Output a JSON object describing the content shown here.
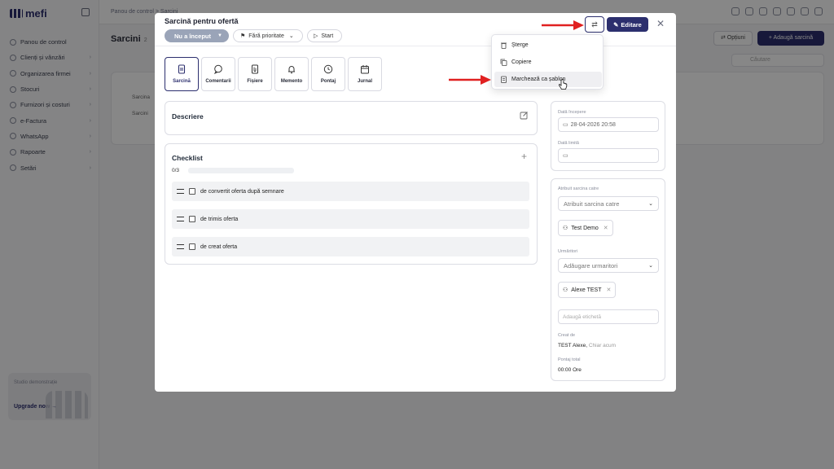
{
  "app": {
    "logo": "mefi",
    "breadcrumb": "Panou de control  >  Sarcini",
    "page_title": "Sarcini",
    "page_count": "2",
    "buttons": {
      "options": "⇄ Opțiuni",
      "add_task": "+ Adaugă sarcină"
    },
    "search_placeholder": "Căutare",
    "sidebar": [
      {
        "label": "Panou de control"
      },
      {
        "label": "Clienți și vânzări"
      },
      {
        "label": "Organizarea firmei"
      },
      {
        "label": "Stocuri"
      },
      {
        "label": "Furnizori și costuri"
      },
      {
        "label": "e-Factura"
      },
      {
        "label": "WhatsApp"
      },
      {
        "label": "Rapoarte"
      },
      {
        "label": "Setări"
      }
    ],
    "upgrade": {
      "text": "Studio demonstrație",
      "link": "Upgrade now →"
    },
    "table_rows": [
      "Sarcina",
      "Sarcini"
    ]
  },
  "modal": {
    "title": "Sarcină pentru ofertă",
    "status": "Nu a început",
    "priority": "Fără prioritate",
    "start": "Start",
    "edit": "Editare",
    "tabs": [
      {
        "label": "Sarcină",
        "icon": "document-icon",
        "active": true
      },
      {
        "label": "Comentarii",
        "icon": "comment-icon",
        "active": false
      },
      {
        "label": "Fișiere",
        "icon": "file-icon",
        "active": false
      },
      {
        "label": "Memento",
        "icon": "bell-icon",
        "active": false
      },
      {
        "label": "Pontaj",
        "icon": "clock-icon",
        "active": false
      },
      {
        "label": "Jurnal",
        "icon": "calendar-icon",
        "active": false
      }
    ],
    "description": {
      "heading": "Descriere"
    },
    "checklist": {
      "heading": "Checklist",
      "progress": "0/3",
      "progress_fraction": 0,
      "items": [
        {
          "text": "de convertit oferta după semnare",
          "checked": false
        },
        {
          "text": "de trimis oferta",
          "checked": false
        },
        {
          "text": "de creat oferta",
          "checked": false
        }
      ]
    },
    "right": {
      "start_date_label": "Dată începere",
      "start_date_value": "28-04-2026 20:58",
      "due_date_label": "Dată limită",
      "due_date_value": "",
      "assign_label": "Atribuit sarcina catre",
      "assign_placeholder": "Atribuit sarcina catre",
      "assignee": "Test Demo",
      "followers_label": "Urmăritori",
      "followers_placeholder": "Adăugare urmaritori",
      "follower": "Alexe TEST",
      "tag_placeholder": "Adaugă etichetă",
      "created_label": "Creat de",
      "created_by": "TEST Alexe,",
      "created_when": "Chiar acum",
      "time_label": "Pontaj total",
      "time_value": "00:00 Ore"
    },
    "menu": [
      {
        "label": "Șterge",
        "icon": "trash-icon"
      },
      {
        "label": "Copiere",
        "icon": "copy-icon"
      },
      {
        "label": "Marchează ca șablon",
        "icon": "template-icon",
        "hover": true
      }
    ]
  },
  "colors": {
    "primary": "#2c2f6e",
    "status": "#9aa4b8",
    "arrow": "#e02020"
  }
}
